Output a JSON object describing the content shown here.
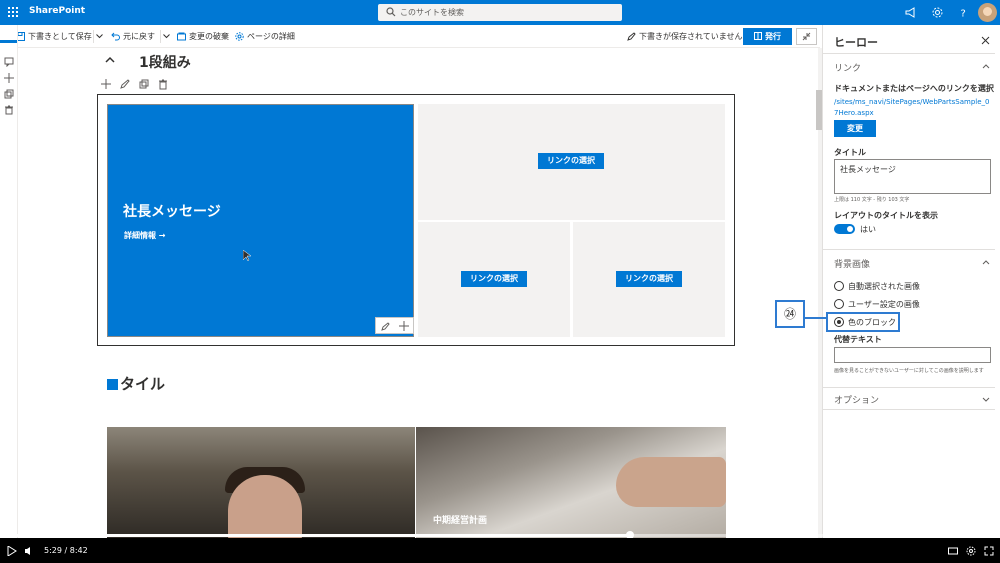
{
  "suitebar": {
    "app_name": "SharePoint",
    "search_placeholder": "このサイトを検索"
  },
  "cmdbar": {
    "save_draft": "下書きとして保存",
    "undo": "元に戻す",
    "discard": "変更の破棄",
    "page_details": "ページの詳細",
    "draft_status": "下書きが保存されていません",
    "publish": "発行"
  },
  "canvas": {
    "section_title": "1段組み",
    "hero": {
      "main_title": "社長メッセージ",
      "main_link": "詳細情報 →",
      "link_btn": "リンクの選択"
    },
    "tile_heading": "タイル",
    "image_right_title": "中期経営計画"
  },
  "panel": {
    "title": "ヒーロー",
    "group_link": "リンク",
    "select_link_label": "ドキュメントまたはページへのリンクを選択",
    "link_path": "/sites/ms_navi/SitePages/WebPartsSample_07Hero.aspx",
    "change_btn": "変更",
    "title_label": "タイトル",
    "title_value": "社長メッセージ",
    "title_hint": "上限は 110 文字 - 残り 103 文字",
    "layout_title_label": "レイアウトのタイトルを表示",
    "toggle_label": "はい",
    "group_background": "背景画像",
    "radio_options": [
      "自動選択された画像",
      "ユーザー設定の画像",
      "色のブロック"
    ],
    "selected_option": "色のブロック",
    "alt_label": "代替テキスト",
    "alt_hint": "画像を見ることができないユーザーに対してこの画像を説明します",
    "group_options": "オプション"
  },
  "annotation": {
    "number": "㉔"
  },
  "player": {
    "time": "5:29 / 8:42",
    "progress": 0.63
  },
  "colors": {
    "accent": "#0078d4",
    "highlight": "#2e7bd1"
  }
}
